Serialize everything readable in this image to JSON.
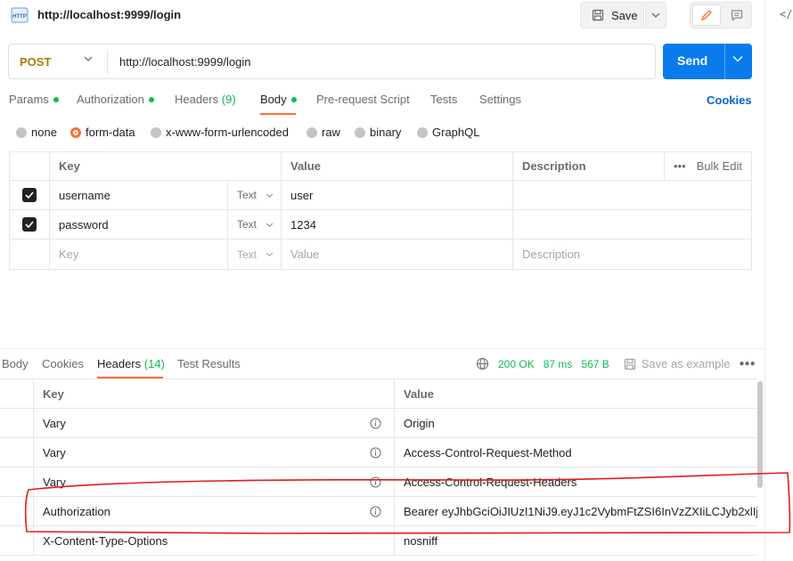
{
  "title": "http://localhost:9999/login",
  "toolbar": {
    "save_label": "Save"
  },
  "request": {
    "method": "POST",
    "url": "http://localhost:9999/login",
    "send_label": "Send"
  },
  "tabs": {
    "params": "Params",
    "authorization": "Authorization",
    "headers": "Headers",
    "headers_count": "(9)",
    "body": "Body",
    "prerequest": "Pre-request Script",
    "tests": "Tests",
    "settings": "Settings",
    "cookies": "Cookies"
  },
  "body_types": [
    "none",
    "form-data",
    "x-www-form-urlencoded",
    "raw",
    "binary",
    "GraphQL"
  ],
  "form_table": {
    "headers": {
      "key": "Key",
      "value": "Value",
      "description": "Description",
      "bulk_edit": "Bulk Edit"
    },
    "rows": [
      {
        "key": "username",
        "type": "Text",
        "value": "user",
        "description": ""
      },
      {
        "key": "password",
        "type": "Text",
        "value": "1234",
        "description": ""
      }
    ],
    "placeholder": {
      "key": "Key",
      "type": "Text",
      "value": "Value",
      "description": "Description"
    }
  },
  "response": {
    "tabs": {
      "body": "Body",
      "cookies": "Cookies",
      "headers": "Headers",
      "headers_count": "(14)",
      "test_results": "Test Results"
    },
    "status": "200 OK",
    "time": "87 ms",
    "size": "567 B",
    "save_example": "Save as example",
    "table_headers": {
      "key": "Key",
      "value": "Value"
    },
    "headers": [
      {
        "key": "Vary",
        "value": "Origin"
      },
      {
        "key": "Vary",
        "value": "Access-Control-Request-Method"
      },
      {
        "key": "Vary",
        "value": "Access-Control-Request-Headers"
      },
      {
        "key": "Authorization",
        "value": "Bearer eyJhbGciOiJIUzI1NiJ9.eyJ1c2VybmFtZSI6InVzZXIiLCJyb2xlIj..."
      },
      {
        "key": "X-Content-Type-Options",
        "value": "nosniff"
      }
    ]
  },
  "colors": {
    "accent": "#ff6c37",
    "send": "#097bed",
    "success": "#0cbb52",
    "method": "#ad7a03",
    "annotation": "#e31b1b"
  }
}
